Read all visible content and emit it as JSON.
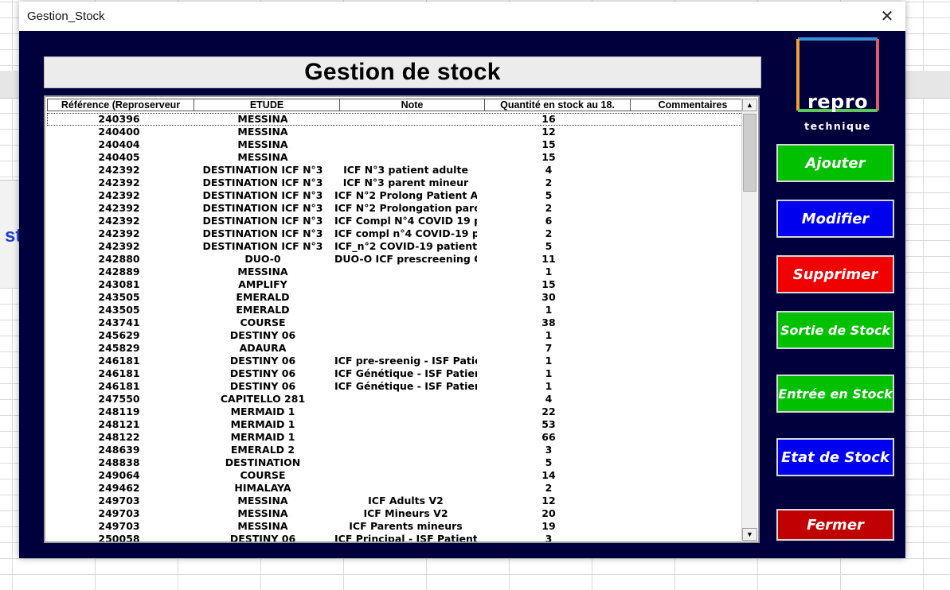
{
  "window": {
    "title": "Gestion_Stock",
    "close_glyph": "✕"
  },
  "background_sheet": {
    "partial_text": "st"
  },
  "heading": "Gestion de stock",
  "table": {
    "columns": [
      "Référence (Reproserveur",
      "ETUDE",
      "Note",
      "Quantité en stock  au 18.",
      "Commentaires"
    ],
    "selected_row": 0,
    "rows": [
      [
        "240396",
        "MESSINA",
        "",
        "16",
        ""
      ],
      [
        "240400",
        "MESSINA",
        "",
        "12",
        ""
      ],
      [
        "240404",
        "MESSINA",
        "",
        "15",
        ""
      ],
      [
        "240405",
        "MESSINA",
        "",
        "15",
        ""
      ],
      [
        "242392",
        "DESTINATION ICF N°3",
        "ICF N°3 patient adulte",
        "4",
        ""
      ],
      [
        "242392",
        "DESTINATION ICF N°3",
        "ICF N°3 parent  mineur",
        "2",
        ""
      ],
      [
        "242392",
        "DESTINATION ICF N°3",
        "ICF N°2 Prolong  Patient A",
        "5",
        ""
      ],
      [
        "242392",
        "DESTINATION ICF N°3",
        "ICF N°2 Prolongation  parc",
        "2",
        ""
      ],
      [
        "242392",
        "DESTINATION ICF N°3",
        "ICF Compl N°4  COVID 19 p",
        "6",
        ""
      ],
      [
        "242392",
        "DESTINATION ICF N°3",
        "ICF compl n°4  COVID-19 p",
        "2",
        ""
      ],
      [
        "242392",
        "DESTINATION ICF N°3",
        "ICF_n°2 COVID-19  patient",
        "5",
        ""
      ],
      [
        "242880",
        "DUO-0",
        "DUO-O ICF prescreening CS",
        "11",
        ""
      ],
      [
        "242889",
        "MESSINA",
        "",
        "1",
        ""
      ],
      [
        "243081",
        "AMPLIFY",
        "",
        "15",
        ""
      ],
      [
        "243505",
        "EMERALD",
        "",
        "30",
        ""
      ],
      [
        "243505",
        "EMERALD",
        "",
        "1",
        ""
      ],
      [
        "243741",
        "COURSE",
        "",
        "38",
        ""
      ],
      [
        "245629",
        "DESTINY 06",
        "",
        "1",
        ""
      ],
      [
        "245829",
        "ADAURA",
        "",
        "7",
        ""
      ],
      [
        "246181",
        "DESTINY 06",
        "ICF pre-sreenig - ISF Patie",
        "1",
        ""
      ],
      [
        "246181",
        "DESTINY 06",
        "ICF Génétique - ISF Patien",
        "1",
        ""
      ],
      [
        "246181",
        "DESTINY 06",
        "ICF Génétique - ISF Patien",
        "1",
        ""
      ],
      [
        "247550",
        "CAPITELLO 281",
        "",
        "4",
        ""
      ],
      [
        "248119",
        "MERMAID 1",
        "",
        "22",
        ""
      ],
      [
        "248121",
        "MERMAID 1",
        "",
        "53",
        ""
      ],
      [
        "248122",
        "MERMAID 1",
        "",
        "66",
        ""
      ],
      [
        "248639",
        "EMERALD 2",
        "",
        "3",
        ""
      ],
      [
        "248838",
        "DESTINATION",
        "",
        "5",
        ""
      ],
      [
        "249064",
        "COURSE",
        "",
        "14",
        ""
      ],
      [
        "249462",
        "HIMALAYA",
        "",
        "2",
        ""
      ],
      [
        "249703",
        "MESSINA",
        "ICF Adults V2",
        "12",
        ""
      ],
      [
        "249703",
        "MESSINA",
        "ICF Mineurs V2",
        "20",
        ""
      ],
      [
        "249703",
        "MESSINA",
        "ICF Parents mineurs",
        "19",
        ""
      ],
      [
        "250058",
        "DESTINY 06",
        "ICF Principal - ISF Patient I",
        "3",
        ""
      ]
    ]
  },
  "logo": {
    "name": "repro",
    "sub": "technique"
  },
  "buttons": [
    {
      "label": "Ajouter",
      "color": "#00c000"
    },
    {
      "label": "Modifier",
      "color": "#0000f0"
    },
    {
      "label": "Supprimer",
      "color": "#f00000"
    },
    {
      "label": "Sortie de Stock",
      "color": "#00c000"
    },
    {
      "label": "Entrée en Stock",
      "color": "#00c000"
    },
    {
      "label": "Etat de Stock",
      "color": "#0000f0"
    },
    {
      "label": "Fermer",
      "color": "#c00000"
    }
  ],
  "colors": {
    "dialog_bg": "#00003c",
    "logo_top": "#3a8fd8",
    "logo_left": "#f0a030",
    "logo_right": "#e05a6a",
    "logo_bottom": "#5ac85a"
  }
}
